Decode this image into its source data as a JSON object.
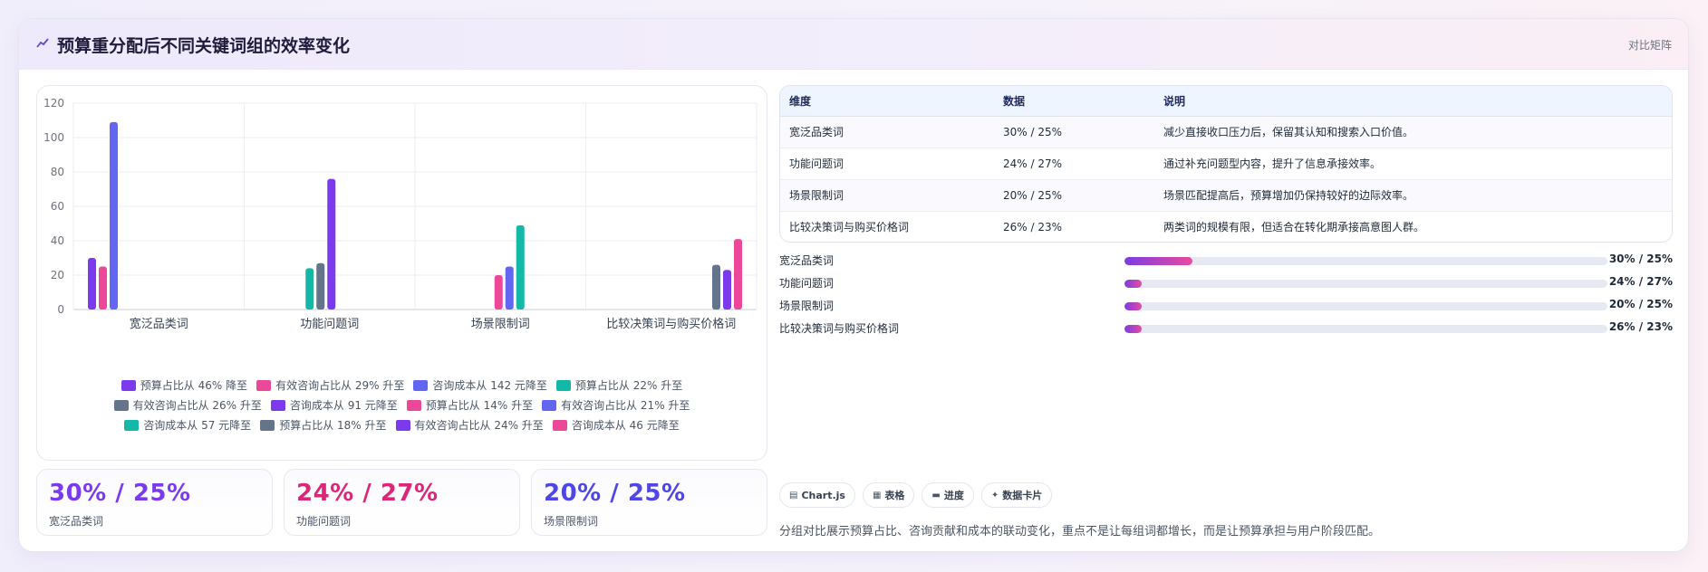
{
  "header": {
    "icon": "line-chart-icon",
    "title": "预算重分配后不同关键词组的效率变化",
    "tag": "对比矩阵"
  },
  "chart_data": {
    "type": "bar",
    "categories": [
      "宽泛品类词",
      "功能问题词",
      "场景限制词",
      "比较决策词与购买价格词"
    ],
    "ylim": [
      0,
      120
    ],
    "yticks": [
      0,
      20,
      40,
      60,
      80,
      100,
      120
    ],
    "grid": true,
    "legend_placement": "bottom",
    "series": [
      {
        "name": "预算占比从 46% 降至",
        "color": "#7c3aed",
        "values": [
          30,
          null,
          null,
          null
        ]
      },
      {
        "name": "有效咨询占比从 29% 升至",
        "color": "#ec4899",
        "values": [
          25,
          null,
          null,
          null
        ]
      },
      {
        "name": "咨询成本从 142 元降至",
        "color": "#6366f1",
        "values": [
          109,
          null,
          null,
          null
        ]
      },
      {
        "name": "预算占比从 22% 升至",
        "color": "#14b8a6",
        "values": [
          null,
          24,
          null,
          null
        ]
      },
      {
        "name": "有效咨询占比从 26% 升至",
        "color": "#64748b",
        "values": [
          null,
          27,
          null,
          null
        ]
      },
      {
        "name": "咨询成本从 91 元降至",
        "color": "#7c3aed",
        "values": [
          null,
          76,
          null,
          null
        ]
      },
      {
        "name": "预算占比从 14% 升至",
        "color": "#ec4899",
        "values": [
          null,
          null,
          20,
          null
        ]
      },
      {
        "name": "有效咨询占比从 21% 升至",
        "color": "#6366f1",
        "values": [
          null,
          null,
          25,
          null
        ]
      },
      {
        "name": "咨询成本从 57 元降至",
        "color": "#14b8a6",
        "values": [
          null,
          null,
          49,
          null
        ]
      },
      {
        "name": "预算占比从 18% 升至",
        "color": "#64748b",
        "values": [
          null,
          null,
          null,
          26
        ]
      },
      {
        "name": "有效咨询占比从 24% 升至",
        "color": "#7c3aed",
        "values": [
          null,
          null,
          null,
          23
        ]
      },
      {
        "name": "咨询成本从 46 元降至",
        "color": "#ec4899",
        "values": [
          null,
          null,
          null,
          41
        ]
      }
    ]
  },
  "kpis": [
    {
      "value": "30% / 25%",
      "label": "宽泛品类词",
      "color": "#7c3aed"
    },
    {
      "value": "24% / 27%",
      "label": "功能问题词",
      "color": "#db2777"
    },
    {
      "value": "20% / 25%",
      "label": "场景限制词",
      "color": "#4f46e5"
    }
  ],
  "table": {
    "headers": [
      "维度",
      "数据",
      "说明"
    ],
    "rows": [
      [
        "宽泛品类词",
        "30% / 25%",
        "减少直接收口压力后，保留其认知和搜索入口价值。"
      ],
      [
        "功能问题词",
        "24% / 27%",
        "通过补充问题型内容，提升了信息承接效率。"
      ],
      [
        "场景限制词",
        "20% / 25%",
        "场景匹配提高后，预算增加仍保持较好的边际效率。"
      ],
      [
        "比较决策词与购买价格词",
        "26% / 23%",
        "两类词的规模有限，但适合在转化期承接高意图人群。"
      ]
    ]
  },
  "progress": [
    {
      "label": "宽泛品类词",
      "value": "30% / 25%",
      "fill": 0.14
    },
    {
      "label": "功能问题词",
      "value": "24% / 27%",
      "fill": 0.035
    },
    {
      "label": "场景限制词",
      "value": "20% / 25%",
      "fill": 0.035
    },
    {
      "label": "比较决策词与购买价格词",
      "value": "26% / 23%",
      "fill": 0.035
    }
  ],
  "chips": [
    {
      "icon": "chart-icon",
      "glyph": "▤",
      "label": "Chart.js"
    },
    {
      "icon": "table-icon",
      "glyph": "▦",
      "label": "表格"
    },
    {
      "icon": "progress-icon",
      "glyph": "▬",
      "label": "进度"
    },
    {
      "icon": "card-icon",
      "glyph": "✦",
      "label": "数据卡片"
    }
  ],
  "footnote": "分组对比展示预算占比、咨询贡献和成本的联动变化，重点不是让每组词都增长，而是让预算承担与用户阶段匹配。"
}
